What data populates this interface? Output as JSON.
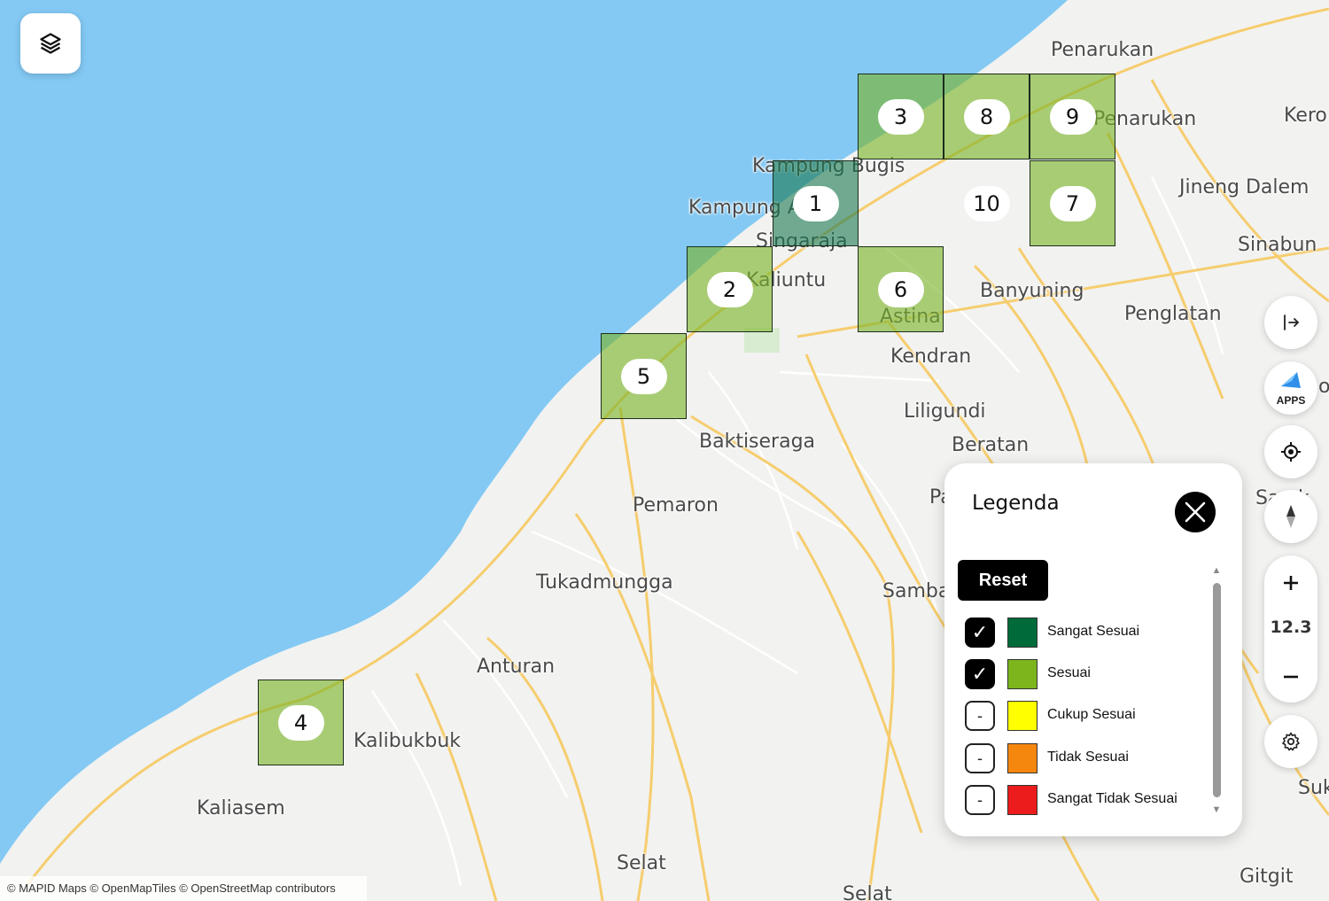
{
  "map": {
    "places": [
      {
        "id": "penarukan-n",
        "name": "Penarukan"
      },
      {
        "id": "penarukan-2",
        "name": "Penarukan"
      },
      {
        "id": "kero",
        "name": "Kero"
      },
      {
        "id": "kampung-bugis",
        "name": "Kampung Bugis"
      },
      {
        "id": "kampung-a",
        "name": "Kampung A"
      },
      {
        "id": "singaraja",
        "name": "Singaraja"
      },
      {
        "id": "kaliuntu",
        "name": "Kaliuntu"
      },
      {
        "id": "jineng-dalem",
        "name": "Jineng Dalem"
      },
      {
        "id": "sinabun",
        "name": "Sinabun"
      },
      {
        "id": "banyuning",
        "name": "Banyuning"
      },
      {
        "id": "penglatan",
        "name": "Penglatan"
      },
      {
        "id": "astina",
        "name": "Astina"
      },
      {
        "id": "kendran",
        "name": "Kendran"
      },
      {
        "id": "liligundi",
        "name": "Liligundi"
      },
      {
        "id": "beratan",
        "name": "Beratan"
      },
      {
        "id": "baktiseraga",
        "name": "Baktiseraga"
      },
      {
        "id": "pemaron",
        "name": "Pemaron"
      },
      {
        "id": "tukadmungga",
        "name": "Tukadmungga"
      },
      {
        "id": "anturan",
        "name": "Anturan"
      },
      {
        "id": "kalibukbuk",
        "name": "Kalibukbuk"
      },
      {
        "id": "kaliasem",
        "name": "Kaliasem"
      },
      {
        "id": "selat",
        "name": "Selat"
      },
      {
        "id": "selat-2",
        "name": "Selat"
      },
      {
        "id": "gitgit",
        "name": "Gitgit"
      },
      {
        "id": "samba",
        "name": "Samba"
      },
      {
        "id": "pa",
        "name": "Pa"
      },
      {
        "id": "suk",
        "name": "Suk"
      },
      {
        "id": "sarinek",
        "name": "Sa  ek"
      },
      {
        "id": "o-edge",
        "name": "o"
      }
    ],
    "grid_cells": [
      {
        "number": "1",
        "class": "sangat"
      },
      {
        "number": "2",
        "class": "sesuai"
      },
      {
        "number": "3",
        "class": "sesuai"
      },
      {
        "number": "4",
        "class": "sesuai"
      },
      {
        "number": "5",
        "class": "sesuai"
      },
      {
        "number": "6",
        "class": "sesuai"
      },
      {
        "number": "7",
        "class": "sesuai"
      },
      {
        "number": "8",
        "class": "sesuai"
      },
      {
        "number": "9",
        "class": "sesuai"
      },
      {
        "number": "10",
        "class": "none"
      }
    ]
  },
  "controls": {
    "layers_icon": "layers-icon",
    "collapse_icon": "collapse-right-icon",
    "apps_label": "APPS",
    "locate_icon": "crosshair-icon",
    "compass_icon": "compass-icon",
    "zoom_in_icon": "plus-icon",
    "zoom_level": "12.3",
    "zoom_out_icon": "minus-icon",
    "settings_icon": "gear-icon"
  },
  "legend": {
    "title": "Legenda",
    "reset_label": "Reset",
    "items": [
      {
        "label": "Sangat Sesuai",
        "color": "#006b3a",
        "checked": true
      },
      {
        "label": "Sesuai",
        "color": "#7cb51c",
        "checked": true
      },
      {
        "label": "Cukup Sesuai",
        "color": "#ffff00",
        "checked": false
      },
      {
        "label": "Tidak Sesuai",
        "color": "#f5870f",
        "checked": false
      },
      {
        "label": "Sangat Tidak Sesuai",
        "color": "#ed1c1c",
        "checked": false
      }
    ],
    "checked_mark": "✓",
    "unchecked_mark": "-"
  },
  "colors": {
    "sea": "#83c9f4",
    "land": "#f2f2f0",
    "road": "#f6cd6e"
  },
  "attribution": "© MAPID Maps © OpenMapTiles © OpenStreetMap contributors"
}
